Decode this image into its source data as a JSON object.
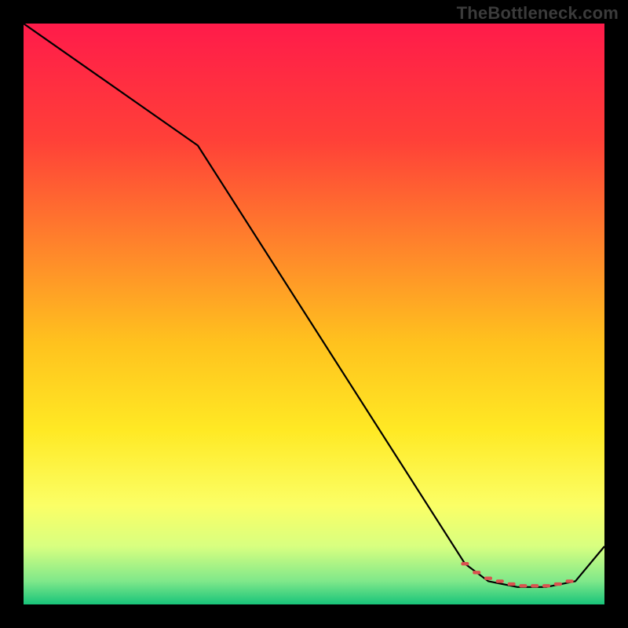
{
  "watermark": "TheBottleneck.com",
  "chart_data": {
    "type": "line",
    "title": "",
    "xlabel": "",
    "ylabel": "",
    "xlim": [
      0,
      100
    ],
    "ylim": [
      0,
      100
    ],
    "grid": false,
    "legend": false,
    "series": [
      {
        "name": "curve",
        "x": [
          0,
          30,
          76,
          80,
          85,
          90,
          95,
          100
        ],
        "values": [
          100,
          79,
          7,
          4,
          3,
          3,
          4,
          10
        ]
      }
    ],
    "markers": {
      "name": "highlight-dots",
      "color": "#d9534f",
      "x": [
        76,
        78,
        80,
        82,
        84,
        86,
        88,
        90,
        92,
        94
      ],
      "values": [
        7,
        5.5,
        4.5,
        4,
        3.5,
        3.2,
        3.2,
        3.2,
        3.5,
        4
      ]
    },
    "background_gradient": {
      "stops": [
        {
          "offset": 0.0,
          "color": "#ff1b4a"
        },
        {
          "offset": 0.2,
          "color": "#ff4038"
        },
        {
          "offset": 0.4,
          "color": "#ff8a2a"
        },
        {
          "offset": 0.55,
          "color": "#ffc21e"
        },
        {
          "offset": 0.7,
          "color": "#ffe924"
        },
        {
          "offset": 0.83,
          "color": "#fbff66"
        },
        {
          "offset": 0.9,
          "color": "#d8ff80"
        },
        {
          "offset": 0.96,
          "color": "#7fe88a"
        },
        {
          "offset": 1.0,
          "color": "#18c47a"
        }
      ]
    }
  }
}
